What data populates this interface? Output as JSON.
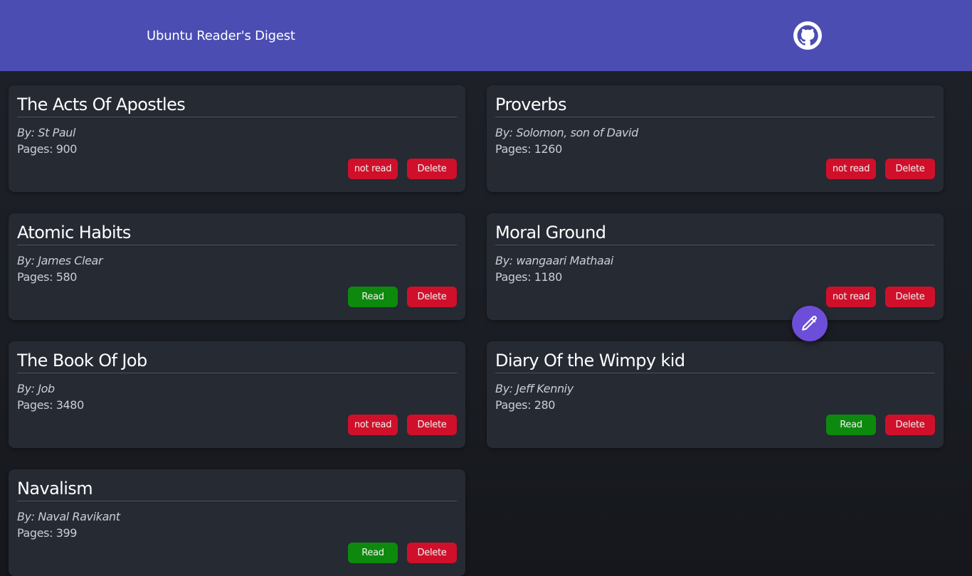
{
  "header": {
    "title": "Ubuntu Reader's Digest",
    "github_icon": "github-icon"
  },
  "colors": {
    "header_bg": "#4b4db3",
    "card_bg": "#262a33",
    "not_read": "#d0102a",
    "read": "#0d8a0d",
    "delete": "#d0102a",
    "fab": "#6d4ed8"
  },
  "books": [
    {
      "title": "The Acts Of Apostles",
      "author": "By: St Paul",
      "pages": "Pages: 900",
      "status": "not read",
      "delete": "Delete"
    },
    {
      "title": "Proverbs",
      "author": "By: Solomon, son of David",
      "pages": "Pages: 1260",
      "status": "not read",
      "delete": "Delete"
    },
    {
      "title": "Atomic Habits",
      "author": "By: James Clear",
      "pages": "Pages: 580",
      "status": "Read",
      "delete": "Delete"
    },
    {
      "title": "Moral Ground",
      "author": "By: wangaari Mathaai",
      "pages": "Pages: 1180",
      "status": "not read",
      "delete": "Delete"
    },
    {
      "title": "The Book Of Job",
      "author": "By: Job",
      "pages": "Pages: 3480",
      "status": "not read",
      "delete": "Delete"
    },
    {
      "title": "Diary Of the Wimpy kid",
      "author": "By: Jeff Kenniy",
      "pages": "Pages: 280",
      "status": "Read",
      "delete": "Delete"
    },
    {
      "title": "Navalism",
      "author": "By: Naval Ravikant",
      "pages": "Pages: 399",
      "status": "Read",
      "delete": "Delete"
    }
  ],
  "fab": {
    "icon": "pencil-icon"
  }
}
